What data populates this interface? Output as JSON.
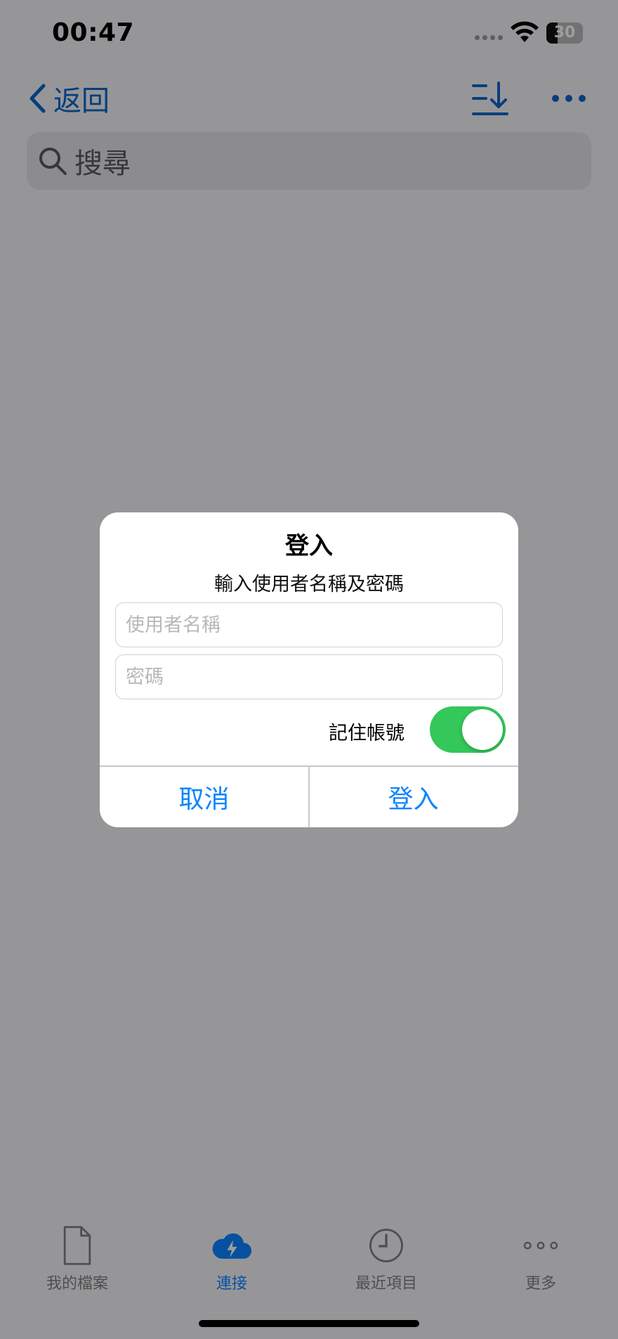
{
  "status_bar": {
    "time": "00:47",
    "battery": "30"
  },
  "nav": {
    "back_label": "返回"
  },
  "search": {
    "placeholder": "搜尋"
  },
  "tabs": [
    {
      "label": "我的檔案",
      "icon": "document-icon",
      "active": false
    },
    {
      "label": "連接",
      "icon": "cloud-bolt-icon",
      "active": true
    },
    {
      "label": "最近項目",
      "icon": "clock-icon",
      "active": false
    },
    {
      "label": "更多",
      "icon": "more-dots-icon",
      "active": false
    }
  ],
  "dialog": {
    "title": "登入",
    "message": "輸入使用者名稱及密碼",
    "username_placeholder": "使用者名稱",
    "password_placeholder": "密碼",
    "remember_label": "記住帳號",
    "remember_enabled": true,
    "cancel_label": "取消",
    "login_label": "登入"
  },
  "colors": {
    "accent": "#0a84ff",
    "toggle_on": "#34c759",
    "link": "#0a64c8"
  }
}
